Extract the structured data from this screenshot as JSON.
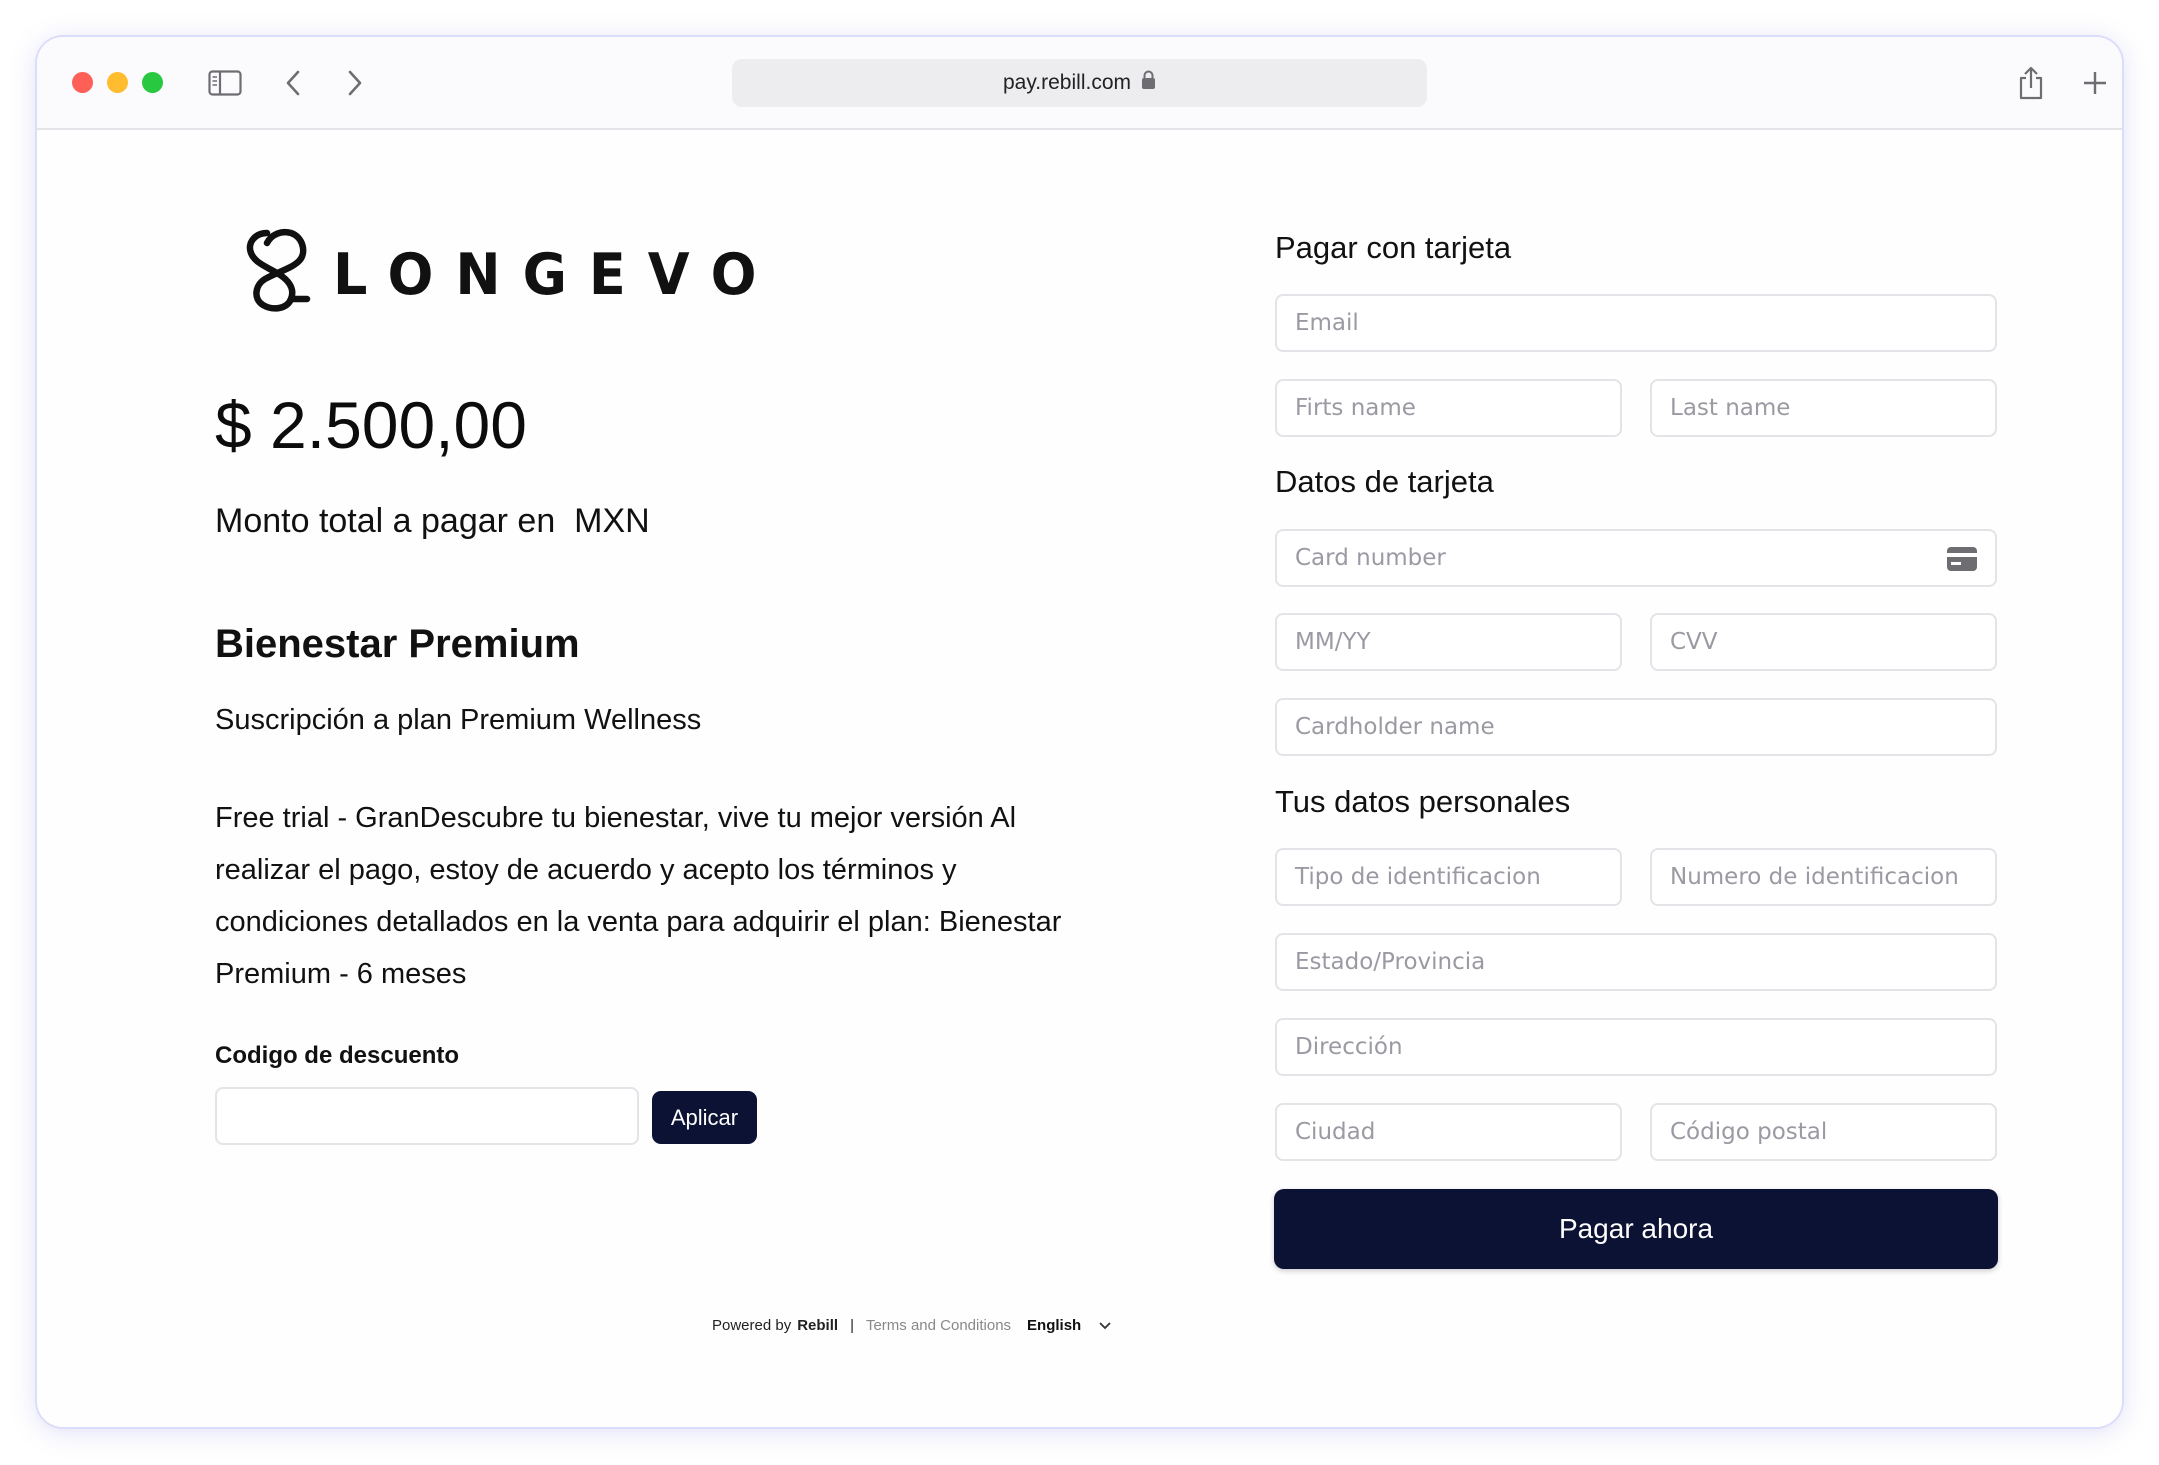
{
  "browser": {
    "url": "pay.rebill.com"
  },
  "brand": {
    "name": "LONGEVO"
  },
  "summary": {
    "amount": "$ 2.500,00",
    "total_label": "Monto total a pagar en  MXN",
    "plan_title": "Bienestar Premium",
    "plan_subtitle": "Suscripción a plan Premium Wellness",
    "plan_description": "Free trial - GranDescubre tu bienestar, vive tu mejor versión Al realizar el pago, estoy de acuerdo y acepto los términos y condiciones detallados en la venta para adquirir el plan: Bienestar Premium - 6 meses"
  },
  "discount": {
    "label": "Codigo de descuento",
    "value": "",
    "apply_label": "Aplicar"
  },
  "form": {
    "pay_with_card_title": "Pagar con tarjeta",
    "email_placeholder": "Email",
    "first_name_placeholder": "Firts name",
    "last_name_placeholder": "Last name",
    "card_data_title": "Datos de tarjeta",
    "card_number_placeholder": "Card number",
    "expiry_placeholder": "MM/YY",
    "cvv_placeholder": "CVV",
    "cardholder_placeholder": "Cardholder name",
    "personal_data_title": "Tus datos personales",
    "id_type_placeholder": "Tipo de identificacion",
    "id_number_placeholder": "Numero de identificacion",
    "state_placeholder": "Estado/Provincia",
    "address_placeholder": "Dirección",
    "city_placeholder": "Ciudad",
    "postal_placeholder": "Código postal",
    "pay_button": "Pagar ahora"
  },
  "footer": {
    "powered_by": "Powered by",
    "provider": "Rebill",
    "separator": "|",
    "terms": "Terms and Conditions",
    "language": "English"
  },
  "colors": {
    "primary_button": "#0b1233",
    "field_border": "#e4e4e8",
    "placeholder": "#9a9aa3"
  }
}
